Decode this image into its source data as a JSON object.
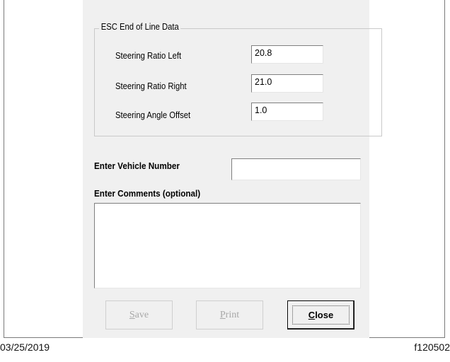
{
  "group": {
    "title": "ESC End of Line Data",
    "fields": [
      {
        "label": "Steering Ratio Left",
        "value": "20.8"
      },
      {
        "label": "Steering Ratio Right",
        "value": "21.0"
      },
      {
        "label": "Steering Angle Offset",
        "value": "1.0"
      }
    ]
  },
  "vehicle": {
    "label": "Enter Vehicle Number",
    "value": ""
  },
  "comments": {
    "label": "Enter Comments (optional)",
    "value": ""
  },
  "buttons": {
    "save": {
      "first": "S",
      "rest": "ave"
    },
    "print": {
      "first": "P",
      "rest": "rint"
    },
    "close": {
      "first": "C",
      "rest": "lose"
    }
  },
  "footer": {
    "date": "03/25/2019",
    "figure_id": "f120502"
  }
}
